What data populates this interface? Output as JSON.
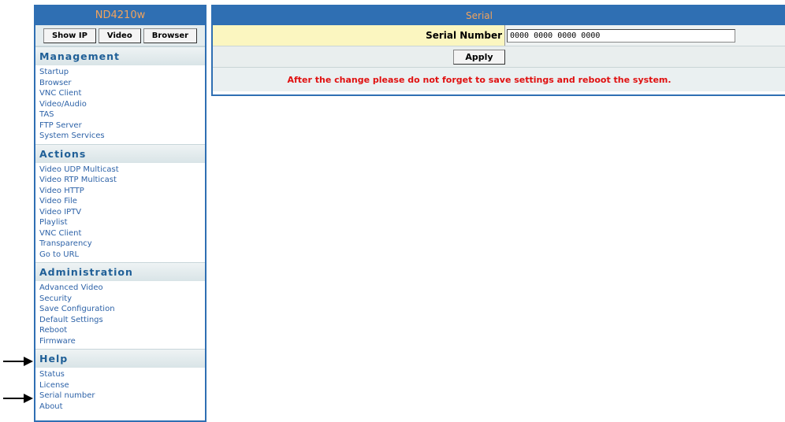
{
  "sidebar": {
    "title": "ND4210w",
    "buttons": [
      "Show IP",
      "Video",
      "Browser"
    ],
    "sections": [
      {
        "title": "Management",
        "items": [
          "Startup",
          "Browser",
          "VNC Client",
          "Video/Audio",
          "TAS",
          "FTP Server",
          "System Services"
        ]
      },
      {
        "title": "Actions",
        "items": [
          "Video UDP Multicast",
          "Video RTP Multicast",
          "Video HTTP",
          "Video File",
          "Video IPTV",
          "Playlist",
          "VNC Client",
          "Transparency",
          "Go to URL"
        ]
      },
      {
        "title": "Administration",
        "items": [
          "Advanced Video",
          "Security",
          "Save Configuration",
          "Default Settings",
          "Reboot",
          "Firmware"
        ]
      },
      {
        "title": "Help",
        "items": [
          "Status",
          "License",
          "Serial number",
          "About"
        ]
      }
    ]
  },
  "main": {
    "title": "Serial",
    "serial_label": "Serial Number",
    "serial_value": "0000 0000 0000 0000",
    "apply_label": "Apply",
    "warning": "After the change please do not forget to save settings and reboot the system."
  },
  "colors": {
    "header_bg": "#2f6fb3",
    "header_text": "#f2a35c",
    "link": "#2e63a8",
    "warning": "#e01010"
  }
}
